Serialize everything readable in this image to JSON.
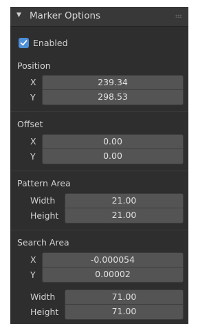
{
  "panel": {
    "title": "Marker Options",
    "enabled_label": "Enabled",
    "enabled": true
  },
  "position": {
    "label": "Position",
    "x_label": "X",
    "y_label": "Y",
    "x": "239.34",
    "y": "298.53"
  },
  "offset": {
    "label": "Offset",
    "x_label": "X",
    "y_label": "Y",
    "x": "0.00",
    "y": "0.00"
  },
  "pattern_area": {
    "label": "Pattern Area",
    "width_label": "Width",
    "height_label": "Height",
    "width": "21.00",
    "height": "21.00"
  },
  "search_area": {
    "label": "Search Area",
    "x_label": "X",
    "y_label": "Y",
    "x": "-0.000054",
    "y": "0.00002",
    "width_label": "Width",
    "height_label": "Height",
    "width": "71.00",
    "height": "71.00"
  },
  "colors": {
    "panel_bg": "#2e2e2e",
    "header_bg": "#383838",
    "field_bg": "#545454",
    "checkbox": "#4d8fd6"
  },
  "icons": {
    "collapse": "triangle-down-icon",
    "drag": "grip-dots-icon",
    "check": "checkmark-icon"
  }
}
